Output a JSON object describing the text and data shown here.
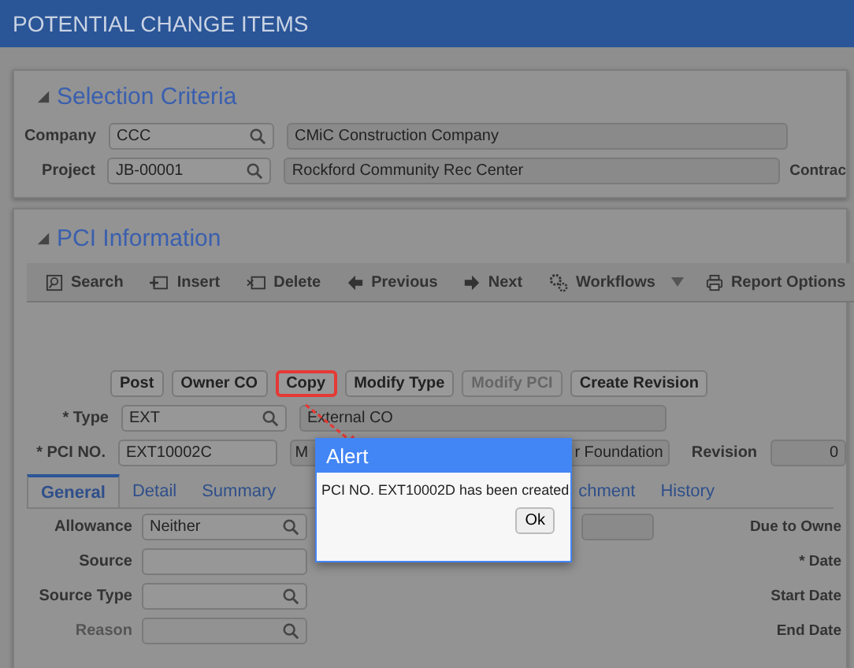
{
  "header": {
    "title": "POTENTIAL CHANGE ITEMS"
  },
  "selection": {
    "title": "Selection Criteria",
    "expanded": true,
    "rows": [
      {
        "label": "Company",
        "value": "CCC",
        "description": "CMiC Construction Company"
      },
      {
        "label": "Project",
        "value": "JB-00001",
        "description": "Rockford Community Rec Center",
        "extra_label": "Contrac"
      }
    ]
  },
  "pci": {
    "title": "PCI Information",
    "expanded": true,
    "toolbar": [
      {
        "label": "Search",
        "kind": "search"
      },
      {
        "label": "Insert",
        "kind": "insert"
      },
      {
        "label": "Delete",
        "kind": "delete"
      },
      {
        "label": "Previous",
        "kind": "previous"
      },
      {
        "label": "Next",
        "kind": "next"
      },
      {
        "label": "Workflows",
        "kind": "workflows",
        "dropdown": true
      },
      {
        "label": "Report Options",
        "kind": "print"
      }
    ],
    "actions": [
      {
        "label": "Post",
        "disabled": false,
        "highlighted": false
      },
      {
        "label": "Owner CO",
        "disabled": false,
        "highlighted": false
      },
      {
        "label": "Copy",
        "disabled": false,
        "highlighted": true
      },
      {
        "label": "Modify Type",
        "disabled": false,
        "highlighted": false
      },
      {
        "label": "Modify PCI",
        "disabled": true,
        "highlighted": false
      },
      {
        "label": "Create Revision",
        "disabled": false,
        "highlighted": false
      }
    ],
    "type": {
      "label": "* Type",
      "value": "EXT",
      "description": "External CO"
    },
    "pci_no": {
      "label": "* PCI NO.",
      "value": "EXT10002C",
      "description": "M",
      "description_2": "r Foundation",
      "revision_label": "Revision",
      "revision_value": "0"
    },
    "tabs": [
      {
        "label": "General",
        "selected": true
      },
      {
        "label": "Detail",
        "selected": false
      },
      {
        "label": "Summary",
        "selected": false
      },
      {
        "label": "chment",
        "selected": false
      },
      {
        "label": "History",
        "selected": false
      }
    ],
    "form": [
      {
        "label": "Allowance",
        "value": "Neither",
        "lookup": true,
        "disabled": false,
        "right_label": "Due to Owne"
      },
      {
        "label": "Source",
        "lookup": false,
        "disabled": false,
        "right_label": "* Date"
      },
      {
        "label": "Source Type",
        "lookup": true,
        "disabled": false,
        "right_label": "Start Date"
      },
      {
        "label": "Reason",
        "lookup": true,
        "disabled": true,
        "right_label": "End Date"
      }
    ]
  },
  "alert": {
    "title": "Alert",
    "message": "PCI NO. EXT10002D has been created",
    "button": "Ok"
  }
}
